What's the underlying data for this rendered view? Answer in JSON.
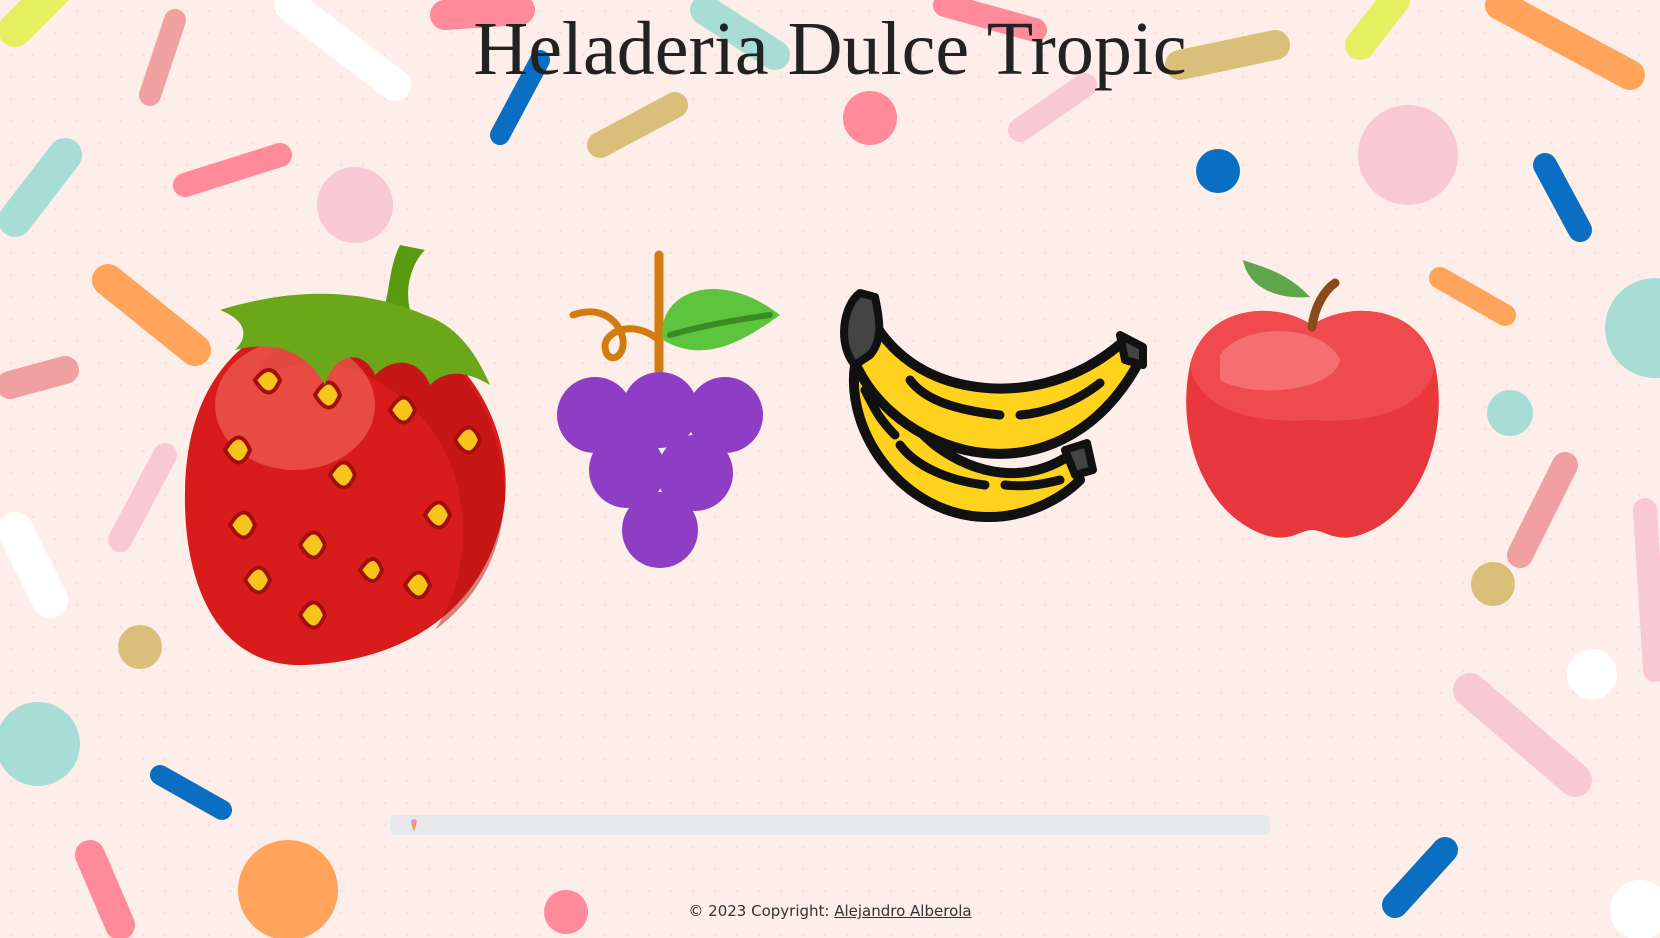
{
  "title": "Heladeria Dulce Tropic",
  "fruits": [
    {
      "name": "strawberry",
      "icon": "strawberry-icon"
    },
    {
      "name": "grapes",
      "icon": "grapes-icon"
    },
    {
      "name": "banana",
      "icon": "banana-icon"
    },
    {
      "name": "apple",
      "icon": "apple-icon"
    }
  ],
  "progress": {
    "icon": "ice-cream-icon",
    "value": 0.02
  },
  "footer": {
    "prefix": "© 2023 Copyright: ",
    "author": "Alejandro Alberola"
  },
  "colors": {
    "background": "#fdeeea",
    "title": "#222222",
    "progress_track": "#e6e9ec"
  }
}
